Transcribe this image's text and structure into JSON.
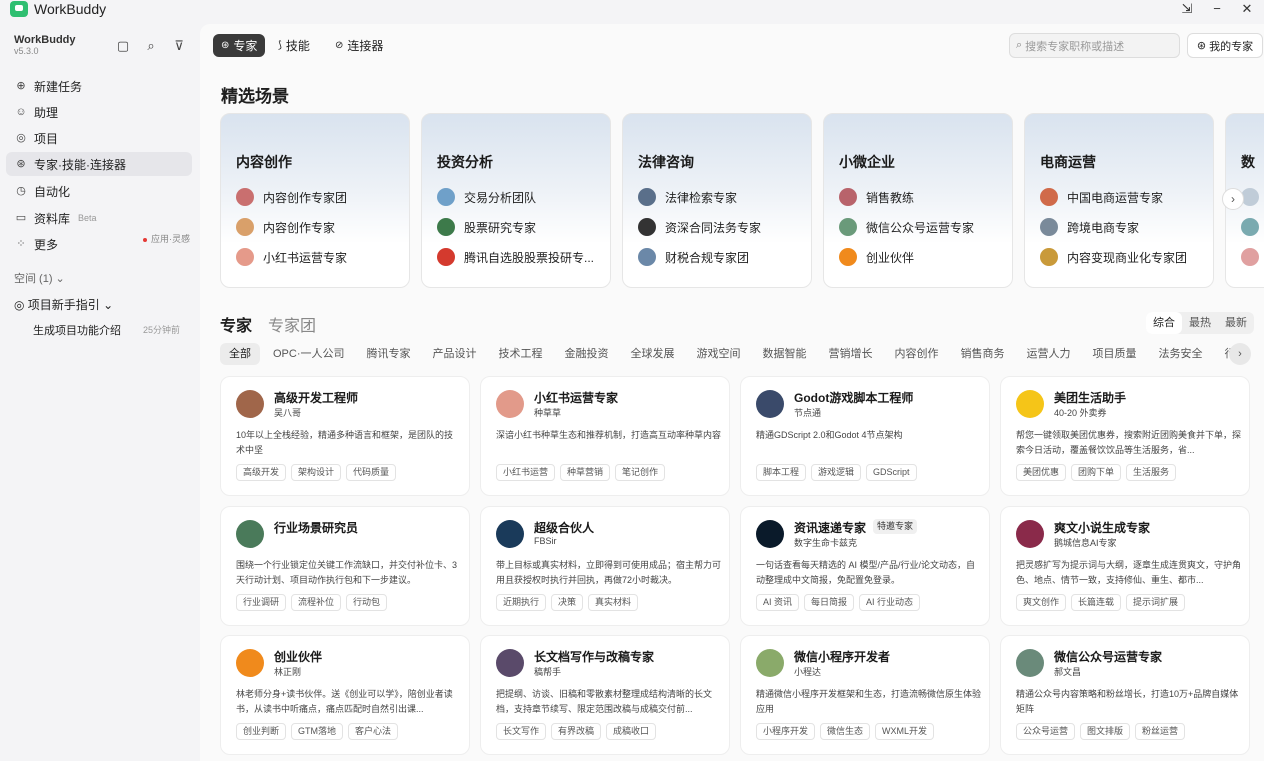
{
  "app": {
    "name": "WorkBuddy",
    "minimize": "−",
    "close": "✕",
    "pin": "⇲"
  },
  "sidebar": {
    "brand": "WorkBuddy",
    "version": "v5.3.0",
    "nav": [
      {
        "label": "新建任务",
        "icon": "plus-circle-icon",
        "glyph": "⊕"
      },
      {
        "label": "助理",
        "icon": "assistant-icon",
        "glyph": "☺"
      },
      {
        "label": "项目",
        "icon": "project-icon",
        "glyph": "◎"
      },
      {
        "label": "专家·技能·连接器",
        "icon": "expert-icon",
        "glyph": "⊛"
      },
      {
        "label": "自动化",
        "icon": "automation-icon",
        "glyph": "◷"
      },
      {
        "label": "资料库",
        "icon": "library-icon",
        "glyph": "▭",
        "beta": "Beta"
      },
      {
        "label": "更多",
        "icon": "more-icon",
        "glyph": "⁘"
      }
    ],
    "more_hint": "应用·灵感",
    "space_label": "空间 (1) ⌄",
    "project_guide": "◎  项目新手指引  ⌄",
    "gen_intro": "生成项目功能介绍",
    "gen_time": "25分钟前"
  },
  "topbar": {
    "tabs": [
      {
        "label": "专家",
        "glyph": "⊛"
      },
      {
        "label": "技能",
        "glyph": "⟆"
      },
      {
        "label": "连接器",
        "glyph": "⊘"
      }
    ],
    "search_placeholder": "搜索专家职称或描述",
    "my_experts": "我的专家"
  },
  "scenes": {
    "title": "精选场景",
    "items": [
      {
        "title": "内容创作",
        "entries": [
          "内容创作专家团",
          "内容创作专家",
          "小红书运营专家"
        ],
        "colors": [
          "#c96f6f",
          "#d9a06a",
          "#e59a8a"
        ]
      },
      {
        "title": "投资分析",
        "entries": [
          "交易分析团队",
          "股票研究专家",
          "腾讯自选股股票投研专..."
        ],
        "colors": [
          "#6fa0c9",
          "#3d7a4a",
          "#d43a2e"
        ]
      },
      {
        "title": "法律咨询",
        "entries": [
          "法律检索专家",
          "资深合同法务专家",
          "财税合规专家团"
        ],
        "colors": [
          "#5a6f8a",
          "#333333",
          "#6b88a8"
        ]
      },
      {
        "title": "小微企业",
        "entries": [
          "销售教练",
          "微信公众号运营专家",
          "创业伙伴"
        ],
        "colors": [
          "#b8636b",
          "#6a9a7a",
          "#f08a1c"
        ]
      },
      {
        "title": "电商运营",
        "entries": [
          "中国电商运营专家",
          "跨境电商专家",
          "内容变现商业化专家团"
        ],
        "colors": [
          "#d06a4a",
          "#7a8a9a",
          "#c99a3a"
        ]
      },
      {
        "title": "数",
        "entries": [
          "",
          "",
          ""
        ],
        "colors": [
          "#c0ccd8",
          "#7aaab0",
          "#e0a0a0"
        ]
      }
    ],
    "next": "›"
  },
  "experts": {
    "tab_experts": "专家",
    "tab_teams": "专家团",
    "sort": [
      "综合",
      "最热",
      "最新"
    ],
    "categories": [
      "全部",
      "OPC·一人公司",
      "腾讯专家",
      "产品设计",
      "技术工程",
      "金融投资",
      "全球发展",
      "游戏空间",
      "数据智能",
      "营销增长",
      "内容创作",
      "销售商务",
      "运营人力",
      "项目质量",
      "法务安全",
      "行"
    ],
    "cat_next": "›",
    "cards": [
      {
        "name": "高级开发工程师",
        "sub": "吴八哥",
        "desc": "10年以上全栈经验，精通多种语言和框架，是团队的技术中坚",
        "tags": [
          "高级开发",
          "架构设计",
          "代码质量"
        ],
        "color": "#a0664a"
      },
      {
        "name": "小红书运营专家",
        "sub": "种草草",
        "desc": "深谙小红书种草生态和推荐机制，打造高互动率种草内容",
        "tags": [
          "小红书运营",
          "种草营销",
          "笔记创作"
        ],
        "color": "#e29a8a"
      },
      {
        "name": "Godot游戏脚本工程师",
        "sub": "节点通",
        "desc": "精通GDScript 2.0和Godot 4节点架构",
        "tags": [
          "脚本工程",
          "游戏逻辑",
          "GDScript"
        ],
        "color": "#3a4a6a"
      },
      {
        "name": "美团生活助手",
        "sub": "40-20 外卖券",
        "desc": "帮您一键领取美团优惠券，搜索附近团购美食并下单，探索今日活动，覆盖餐饮饮品等生活服务，省...",
        "tags": [
          "美团优惠",
          "团购下单",
          "生活服务"
        ],
        "color": "#f5c518"
      },
      {
        "name": "行业场景研究员",
        "sub": "",
        "desc": "围绕一个行业锁定位关键工作流缺口，并交付补位卡、3天行动计划、项目动作执行包和下一步建议。",
        "tags": [
          "行业调研",
          "流程补位",
          "行动包"
        ],
        "color": "#4a7a5a"
      },
      {
        "name": "超级合伙人",
        "sub": "FBSir",
        "desc": "带上目标或真实材料，立即得到可使用成品；宿主帮力可用且获授权时执行并回执，再做72小时裁决。",
        "tags": [
          "近期执行",
          "决策",
          "真实材料"
        ],
        "color": "#1a3a5a"
      },
      {
        "name": "资讯速递专家",
        "sub": "数字生命卡兹克",
        "badge": "特邀专家",
        "desc": "一句话查看每天精选的 AI 模型/产品/行业/论文动态，自动整理成中文简报，免配置免登录。",
        "tags": [
          "AI 资讯",
          "每日简报",
          "AI 行业动态"
        ],
        "color": "#0a1a2a"
      },
      {
        "name": "爽文小说生成专家",
        "sub": "鹅城信息AI专家",
        "desc": "把灵感扩写为提示词与大纲，逐章生成连贯爽文，守护角色、地点、情节一致，支持修仙、重生、都市...",
        "tags": [
          "爽文创作",
          "长篇连载",
          "提示词扩展"
        ],
        "color": "#8a2a4a"
      },
      {
        "name": "创业伙伴",
        "sub": "林正刚",
        "desc": "林老师分身+读书伙伴。送《创业可以学》，陪创业者读书，从读书中听痛点，痛点匹配时自然引出课...",
        "tags": [
          "创业判断",
          "GTM落地",
          "客户心法"
        ],
        "color": "#f08a1c"
      },
      {
        "name": "长文档写作与改稿专家",
        "sub": "稿帮手",
        "desc": "把提纲、访谈、旧稿和零散素材整理成结构清晰的长文档，支持章节续写、限定范围改稿与成稿交付前...",
        "tags": [
          "长文写作",
          "有界改稿",
          "成稿收口"
        ],
        "color": "#5a4a6a"
      },
      {
        "name": "微信小程序开发者",
        "sub": "小程达",
        "desc": "精通微信小程序开发框架和生态，打造流畅微信原生体验应用",
        "tags": [
          "小程序开发",
          "微信生态",
          "WXML开发"
        ],
        "color": "#8aaa6a"
      },
      {
        "name": "微信公众号运营专家",
        "sub": "郝文昌",
        "desc": "精通公众号内容策略和粉丝增长，打造10万+品牌自媒体矩阵",
        "tags": [
          "公众号运营",
          "图文排版",
          "粉丝运营"
        ],
        "color": "#6a8a7a"
      }
    ]
  }
}
